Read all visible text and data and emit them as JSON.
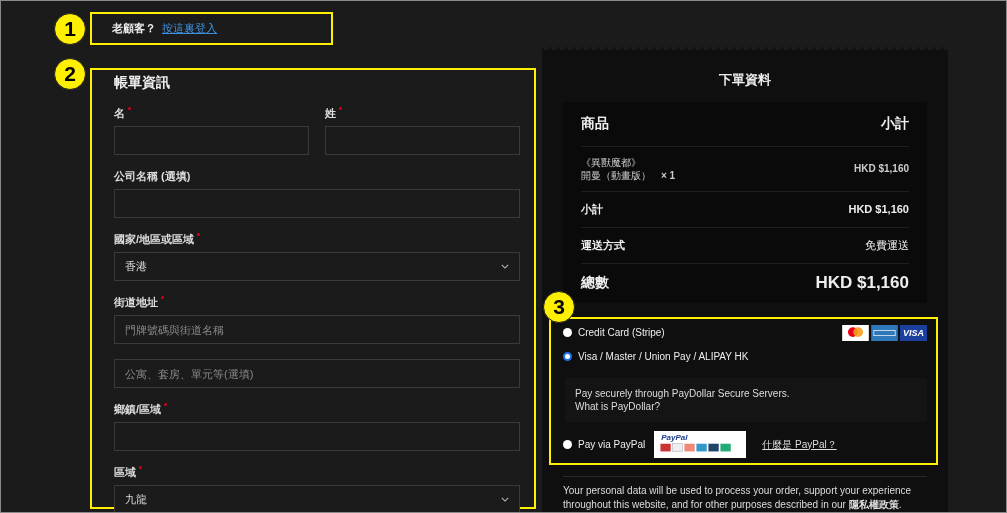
{
  "returning_customer": {
    "marker": "1",
    "text": "老顧客？",
    "link": "按這裏登入"
  },
  "billing": {
    "marker": "2",
    "title": "帳單資訊",
    "rows": [
      [
        {
          "kind": "text",
          "label": "名",
          "required": true
        },
        {
          "kind": "text",
          "label": "姓",
          "required": true
        }
      ],
      [
        {
          "kind": "text",
          "label": "公司名稱 (選填)",
          "required": false
        }
      ],
      [
        {
          "kind": "select",
          "label": "國家/地區或區域",
          "required": true,
          "value": "香港"
        }
      ],
      [
        {
          "kind": "address",
          "label": "街道地址",
          "required": true,
          "placeholders": [
            "門牌號碼與街道名稱",
            "公寓、套房、單元等(選填)"
          ]
        }
      ],
      [
        {
          "kind": "text",
          "label": "鄉鎮/區域",
          "required": true
        }
      ],
      [
        {
          "kind": "select",
          "label": "區域",
          "required": true,
          "value": "九龍"
        }
      ]
    ]
  },
  "order": {
    "title": "下單資料",
    "columns": [
      "商品",
      "小計"
    ],
    "items": [
      {
        "name_lines": [
          "《異獸魔都》",
          "開曼（動畫版）"
        ],
        "quantity": "× 1",
        "price": "HKD $1,160"
      }
    ],
    "totals": [
      {
        "kind": "subtotal",
        "label": "小計",
        "value": "HKD $1,160"
      },
      {
        "kind": "shipping",
        "label": "運送方式",
        "value": "免費運送"
      },
      {
        "kind": "total",
        "label": "總數",
        "value": "HKD $1,160"
      }
    ]
  },
  "payment": {
    "marker": "3",
    "methods": [
      {
        "kind": "cards",
        "label": "Credit Card (Stripe)",
        "selected": false,
        "logo_text": "VISA"
      },
      {
        "kind": "plain",
        "label": "Visa / Master / Union Pay / ALIPAY HK",
        "selected": true,
        "description": [
          "Pay securely through PayDollar Secure Servers.",
          "What is PayDollar?"
        ]
      },
      {
        "kind": "paypal",
        "label": "Pay via PayPal",
        "selected": false,
        "badge_title": "PayPal",
        "link": "什麼是 PayPal？"
      }
    ]
  },
  "privacy": {
    "text": "Your personal data will be used to process your order, support your experience throughout this website, and for other purposes described in our",
    "link": "隱私權政策",
    "end": "."
  }
}
